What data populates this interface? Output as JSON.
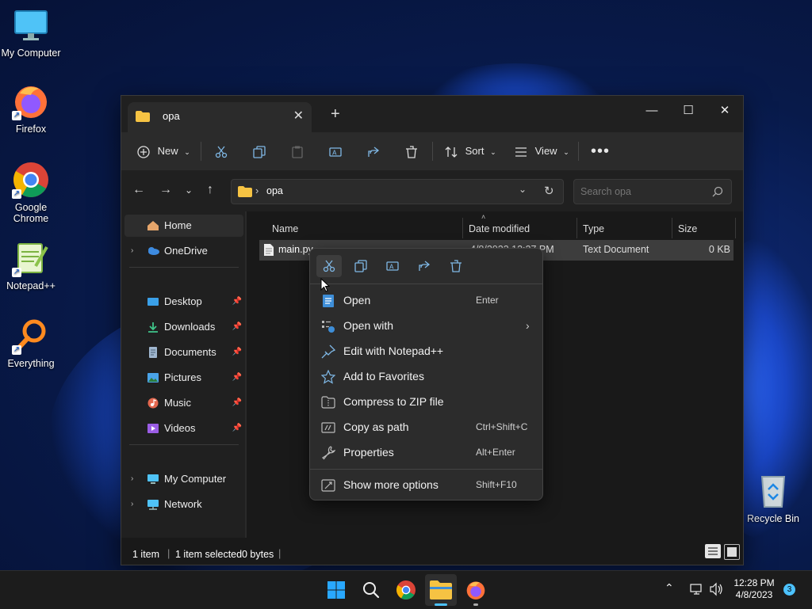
{
  "desktop": {
    "icons": [
      {
        "label": "My Computer"
      },
      {
        "label": "Firefox"
      },
      {
        "label": "Google Chrome"
      },
      {
        "label": "Notepad++"
      },
      {
        "label": "Everything"
      },
      {
        "label": "Recycle Bin"
      }
    ]
  },
  "window": {
    "tab_title": "opa",
    "toolbar": {
      "new_label": "New",
      "sort_label": "Sort",
      "view_label": "View"
    },
    "address": {
      "path_segment": "opa"
    },
    "search": {
      "placeholder": "Search opa"
    },
    "sidebar": {
      "items": [
        {
          "label": "Home"
        },
        {
          "label": "OneDrive"
        },
        {
          "label": "Desktop"
        },
        {
          "label": "Downloads"
        },
        {
          "label": "Documents"
        },
        {
          "label": "Pictures"
        },
        {
          "label": "Music"
        },
        {
          "label": "Videos"
        },
        {
          "label": "My Computer"
        },
        {
          "label": "Network"
        }
      ]
    },
    "columns": {
      "name": "Name",
      "date_modified": "Date modified",
      "type": "Type",
      "size": "Size"
    },
    "files": [
      {
        "name": "main.py",
        "date_modified": "4/8/2023 12:27 PM",
        "type": "Text Document",
        "size": "0 KB"
      }
    ],
    "status": {
      "item_count": "1 item",
      "selection": "1 item selected",
      "bytes": "0 bytes"
    }
  },
  "context_menu": {
    "items": [
      {
        "label": "Open",
        "shortcut": "Enter"
      },
      {
        "label": "Open with",
        "shortcut": ""
      },
      {
        "label": "Edit with Notepad++",
        "shortcut": ""
      },
      {
        "label": "Add to Favorites",
        "shortcut": ""
      },
      {
        "label": "Compress to ZIP file",
        "shortcut": ""
      },
      {
        "label": "Copy as path",
        "shortcut": "Ctrl+Shift+C"
      },
      {
        "label": "Properties",
        "shortcut": "Alt+Enter"
      },
      {
        "label": "Show more options",
        "shortcut": "Shift+F10"
      }
    ]
  },
  "taskbar": {
    "time": "12:28 PM",
    "date": "4/8/2023",
    "notification_count": "3"
  },
  "colors": {
    "accent": "#4cc2ff",
    "folder": "#f6c343"
  }
}
